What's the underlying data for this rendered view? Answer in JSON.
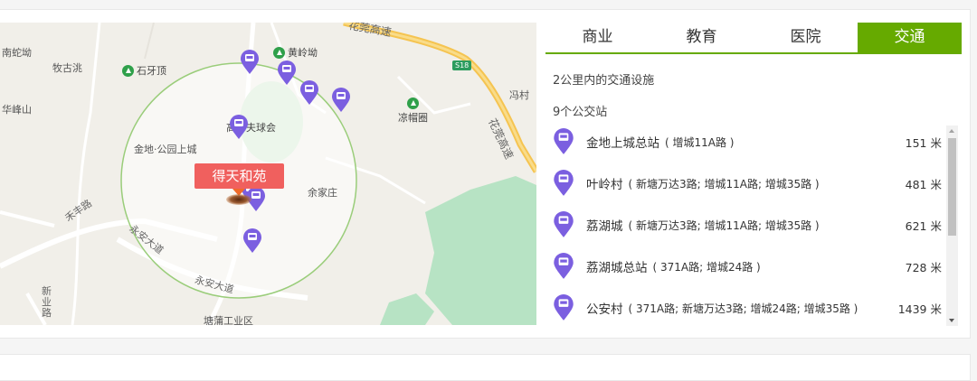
{
  "map": {
    "center_label": "得天和苑",
    "places": [
      "南蛇坳",
      "牧古洮",
      "华峰山",
      "金地·公园上城",
      "余家庄",
      "冯村",
      "禾丰路",
      "永安大道",
      "永安大道",
      "新业路"
    ],
    "pois": [
      "石牙顶",
      "黄岭坳",
      "高尔夫球会",
      "凉帽圈"
    ],
    "highways": [
      "花莞高速",
      "花莞高速"
    ],
    "highway_sign": "S18",
    "bottom_poi": "塘蒲工业区"
  },
  "tabs": [
    {
      "label": "商业",
      "active": false
    },
    {
      "label": "教育",
      "active": false
    },
    {
      "label": "医院",
      "active": false
    },
    {
      "label": "交通",
      "active": true
    }
  ],
  "info": {
    "title": "2公里内的交通设施",
    "count": "9个公交站"
  },
  "stations": [
    {
      "name": "金地上城总站",
      "routes": "( 增城11A路 )",
      "dist": "151 米"
    },
    {
      "name": "叶岭村",
      "routes": "( 新塘万达3路; 增城11A路; 增城35路 )",
      "dist": "481 米"
    },
    {
      "name": "荔湖城",
      "routes": "( 新塘万达3路; 增城11A路; 增城35路 )",
      "dist": "621 米"
    },
    {
      "name": "荔湖城总站",
      "routes": "( 371A路; 增城24路 )",
      "dist": "728 米"
    },
    {
      "name": "公安村",
      "routes": "( 371A路; 新塘万达3路; 增城24路; 增城35路 )",
      "dist": "1439 米"
    }
  ],
  "colors": {
    "accent": "#66aa00",
    "pin": "#7b5fe0",
    "center": "#f0605e"
  }
}
